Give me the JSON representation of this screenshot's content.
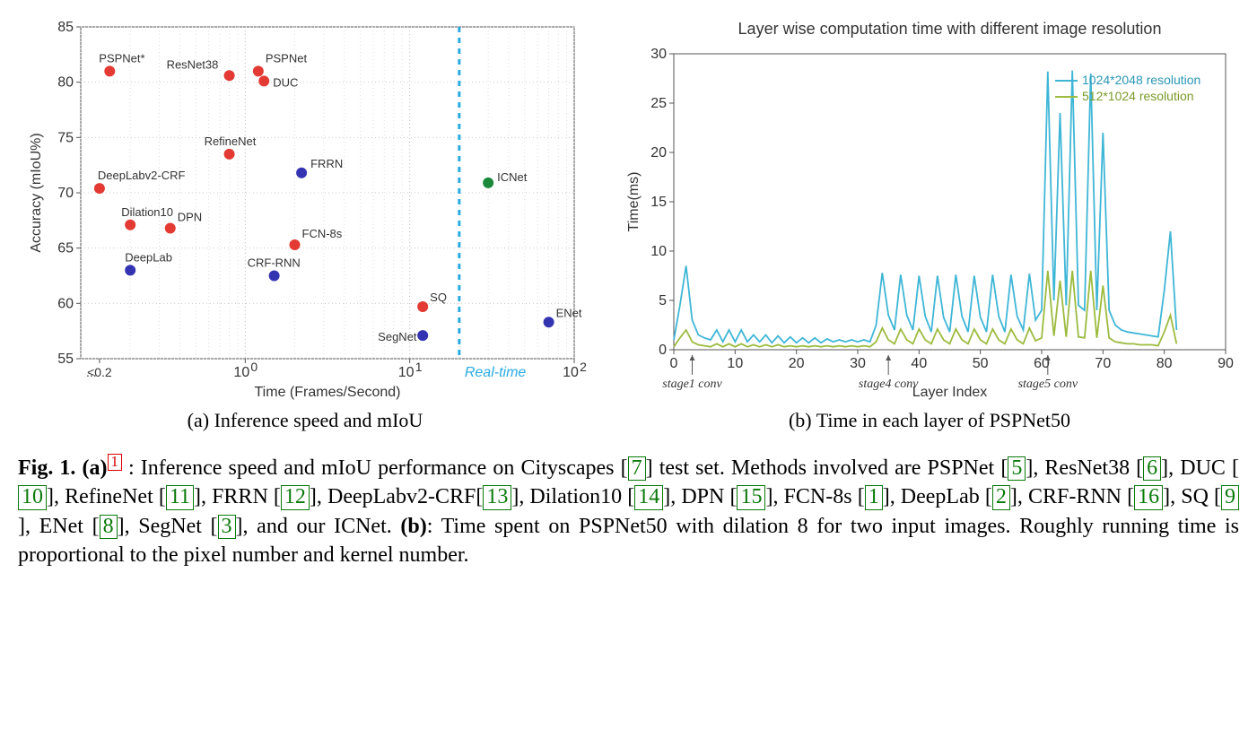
{
  "chart_data": [
    {
      "type": "scatter",
      "title": "",
      "xlabel": "Time (Frames/Second)",
      "ylabel": "Accuracy (mIoU%)",
      "xscale": "log",
      "xlim": [
        0.1,
        100
      ],
      "ylim": [
        55,
        85
      ],
      "realtime_line_x": 20,
      "realtime_label": "Real-time",
      "x_tick_labels": [
        "<0.2",
        "10^0",
        "10^1",
        "10^2"
      ],
      "series": [
        {
          "name": "red",
          "color": "#e33a33",
          "points": [
            {
              "label": "PSPNet*",
              "x": 0.15,
              "y": 81.0,
              "dx": -12,
              "dy": -10,
              "anchor": "start"
            },
            {
              "label": "ResNet38",
              "x": 0.8,
              "y": 80.6,
              "dx": -70,
              "dy": -8,
              "anchor": "start"
            },
            {
              "label": "PSPNet",
              "x": 1.2,
              "y": 81.0,
              "dx": 8,
              "dy": -10,
              "anchor": "start"
            },
            {
              "label": "DUC",
              "x": 1.3,
              "y": 80.1,
              "dx": 10,
              "dy": 6,
              "anchor": "start"
            },
            {
              "label": "RefineNet",
              "x": 0.8,
              "y": 73.5,
              "dx": -28,
              "dy": -10,
              "anchor": "start"
            },
            {
              "label": "DeepLabv2-CRF",
              "x": 0.13,
              "y": 70.4,
              "dx": -2,
              "dy": -10,
              "anchor": "start"
            },
            {
              "label": "Dilation10",
              "x": 0.2,
              "y": 67.1,
              "dx": -10,
              "dy": -10,
              "anchor": "start"
            },
            {
              "label": "DPN",
              "x": 0.35,
              "y": 66.8,
              "dx": 8,
              "dy": -8,
              "anchor": "start"
            },
            {
              "label": "FCN-8s",
              "x": 2.0,
              "y": 65.3,
              "dx": 8,
              "dy": -8,
              "anchor": "start"
            },
            {
              "label": "SQ",
              "x": 12,
              "y": 59.7,
              "dx": 8,
              "dy": -6,
              "anchor": "start"
            }
          ]
        },
        {
          "name": "blue",
          "color": "#3434b3",
          "points": [
            {
              "label": "FRRN",
              "x": 2.2,
              "y": 71.8,
              "dx": 10,
              "dy": -6,
              "anchor": "start"
            },
            {
              "label": "DeepLab",
              "x": 0.2,
              "y": 63.0,
              "dx": -6,
              "dy": -10,
              "anchor": "start"
            },
            {
              "label": "CRF-RNN",
              "x": 1.5,
              "y": 62.5,
              "dx": -30,
              "dy": -10,
              "anchor": "start"
            },
            {
              "label": "SegNet",
              "x": 12,
              "y": 57.1,
              "dx": -50,
              "dy": 6,
              "anchor": "start"
            },
            {
              "label": "ENet",
              "x": 70,
              "y": 58.3,
              "dx": 8,
              "dy": -6,
              "anchor": "start"
            }
          ]
        },
        {
          "name": "green",
          "color": "#1a8a3a",
          "points": [
            {
              "label": "ICNet",
              "x": 30,
              "y": 70.9,
              "dx": 10,
              "dy": -2,
              "anchor": "start"
            }
          ]
        }
      ]
    },
    {
      "type": "line",
      "title": "Layer wise computation time with different image resolution",
      "xlabel": "Layer Index",
      "ylabel": "Time(ms)",
      "xlim": [
        0,
        90
      ],
      "ylim": [
        0,
        30
      ],
      "x_ticks": [
        0,
        10,
        20,
        30,
        40,
        50,
        60,
        70,
        80,
        90
      ],
      "y_ticks": [
        0,
        5,
        10,
        15,
        20,
        25,
        30
      ],
      "legend": [
        {
          "label": "1024*2048 resolution",
          "color": "#3fb6d6"
        },
        {
          "label": "512*1024 resolution",
          "color": "#9cbb3f"
        }
      ],
      "annotations": [
        {
          "label": "stage1 conv",
          "x": 3
        },
        {
          "label": "stage4 conv",
          "x": 35
        },
        {
          "label": "stage5 conv",
          "x": 61
        }
      ],
      "series": [
        {
          "name": "1024*2048 resolution",
          "color": "#3fb6d6",
          "x": [
            0,
            1,
            2,
            3,
            4,
            5,
            6,
            7,
            8,
            9,
            10,
            11,
            12,
            13,
            14,
            15,
            16,
            17,
            18,
            19,
            20,
            21,
            22,
            23,
            24,
            25,
            26,
            27,
            28,
            29,
            30,
            31,
            32,
            33,
            34,
            35,
            36,
            37,
            38,
            39,
            40,
            41,
            42,
            43,
            44,
            45,
            46,
            47,
            48,
            49,
            50,
            51,
            52,
            53,
            54,
            55,
            56,
            57,
            58,
            59,
            60,
            61,
            62,
            63,
            64,
            65,
            66,
            67,
            68,
            69,
            70,
            71,
            72,
            73,
            74,
            75,
            76,
            77,
            78,
            79,
            80,
            81,
            82
          ],
          "y": [
            1.0,
            4.5,
            8.5,
            3.0,
            1.5,
            1.2,
            1.0,
            2.0,
            0.8,
            2.0,
            0.8,
            2.0,
            0.8,
            1.5,
            0.8,
            1.5,
            0.7,
            1.4,
            0.7,
            1.3,
            0.7,
            1.2,
            0.7,
            1.2,
            0.7,
            1.1,
            0.8,
            1.0,
            0.8,
            1.0,
            0.8,
            1.0,
            0.8,
            2.5,
            7.8,
            3.5,
            2.0,
            7.6,
            3.5,
            2.0,
            7.5,
            3.4,
            1.8,
            7.5,
            3.3,
            1.8,
            7.6,
            3.4,
            1.8,
            7.5,
            3.3,
            1.8,
            7.6,
            3.4,
            1.8,
            7.6,
            3.4,
            2.0,
            7.7,
            3.0,
            4.0,
            28.2,
            5.0,
            24.0,
            4.5,
            28.3,
            4.5,
            4.0,
            28.0,
            4.0,
            22.0,
            4.0,
            2.5,
            2.0,
            1.8,
            1.7,
            1.6,
            1.5,
            1.4,
            1.3,
            6.0,
            12.0,
            2.0
          ]
        },
        {
          "name": "512*1024 resolution",
          "color": "#9cbb3f",
          "x": [
            0,
            1,
            2,
            3,
            4,
            5,
            6,
            7,
            8,
            9,
            10,
            11,
            12,
            13,
            14,
            15,
            16,
            17,
            18,
            19,
            20,
            21,
            22,
            23,
            24,
            25,
            26,
            27,
            28,
            29,
            30,
            31,
            32,
            33,
            34,
            35,
            36,
            37,
            38,
            39,
            40,
            41,
            42,
            43,
            44,
            45,
            46,
            47,
            48,
            49,
            50,
            51,
            52,
            53,
            54,
            55,
            56,
            57,
            58,
            59,
            60,
            61,
            62,
            63,
            64,
            65,
            66,
            67,
            68,
            69,
            70,
            71,
            72,
            73,
            74,
            75,
            76,
            77,
            78,
            79,
            80,
            81,
            82
          ],
          "y": [
            0.3,
            1.2,
            2.0,
            0.8,
            0.5,
            0.4,
            0.3,
            0.6,
            0.3,
            0.6,
            0.3,
            0.6,
            0.3,
            0.5,
            0.3,
            0.5,
            0.3,
            0.5,
            0.3,
            0.4,
            0.3,
            0.4,
            0.3,
            0.4,
            0.3,
            0.4,
            0.3,
            0.4,
            0.3,
            0.4,
            0.3,
            0.4,
            0.3,
            0.8,
            2.2,
            1.0,
            0.6,
            2.1,
            1.0,
            0.6,
            2.1,
            1.0,
            0.6,
            2.1,
            1.0,
            0.6,
            2.1,
            1.0,
            0.6,
            2.1,
            1.0,
            0.6,
            2.1,
            1.0,
            0.6,
            2.1,
            1.0,
            0.6,
            2.2,
            0.9,
            1.2,
            8.0,
            1.4,
            7.0,
            1.3,
            8.0,
            1.3,
            1.2,
            8.0,
            1.2,
            6.5,
            1.2,
            0.8,
            0.7,
            0.6,
            0.6,
            0.5,
            0.5,
            0.5,
            0.4,
            1.8,
            3.5,
            0.6
          ]
        }
      ]
    }
  ],
  "subcaptions": {
    "a": "(a) Inference speed and mIoU",
    "b": "(b) Time in each layer of PSPNet50"
  },
  "caption": {
    "fig_label": "Fig. 1.",
    "a_label": "(a)",
    "footnote_mark": "1",
    "a_lead": ": Inference speed and mIoU performance on Cityscapes ",
    "ref_cityscapes": "7",
    "a_mid": " test set. Methods involved are PSPNet ",
    "ref_psp": "5",
    "s_resnet": ", ResNet38 ",
    "ref_resnet": "6",
    "s_duc": ", DUC ",
    "ref_duc": "10",
    "s_refine": ", RefineNet ",
    "ref_refine": "11",
    "s_frrn": ", FRRN ",
    "ref_frrn": "12",
    "s_deeplabv2": ", DeepLabv2-CRF",
    "ref_deeplabv2": "13",
    "s_dilation": ", Dilation10 ",
    "ref_dilation": "14",
    "s_dpn": ", DPN ",
    "ref_dpn": "15",
    "s_fcn": ", FCN-8s ",
    "ref_fcn": "1",
    "s_deeplab": ", DeepLab ",
    "ref_deeplab": "2",
    "s_crfrnn": ", CRF-RNN ",
    "ref_crfrnn": "16",
    "s_sq": ", SQ ",
    "ref_sq": "9",
    "s_enet": ", ENet ",
    "ref_enet": "8",
    "s_segnet": ", SegNet ",
    "ref_segnet": "3",
    "s_icnet": ", and our ICNet. ",
    "b_label": "(b)",
    "b_text": ": Time spent on PSPNet50 with dilation 8 for two input images. Roughly running time is proportional to the pixel number and kernel number."
  }
}
